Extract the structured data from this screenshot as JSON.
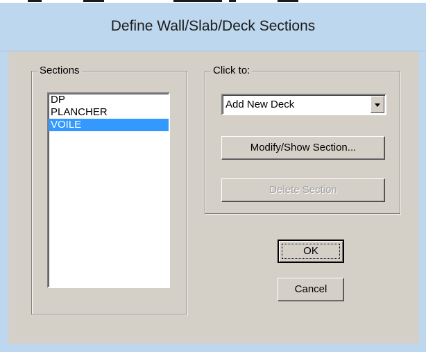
{
  "window": {
    "title": "Define Wall/Slab/Deck Sections"
  },
  "sections_group": {
    "label": "Sections",
    "items": [
      {
        "label": "DP",
        "selected": false
      },
      {
        "label": "PLANCHER",
        "selected": false
      },
      {
        "label": "VOILE",
        "selected": true
      }
    ]
  },
  "click_group": {
    "label": "Click to:",
    "add_combo_value": "Add New Deck",
    "modify_button": "Modify/Show Section...",
    "delete_button": "Delete Section",
    "delete_enabled": false
  },
  "ok_button": "OK",
  "cancel_button": "Cancel",
  "colors": {
    "titlebar": "#bdd7ee",
    "dialog_face": "#d4d0c8",
    "selection": "#3399ff"
  }
}
